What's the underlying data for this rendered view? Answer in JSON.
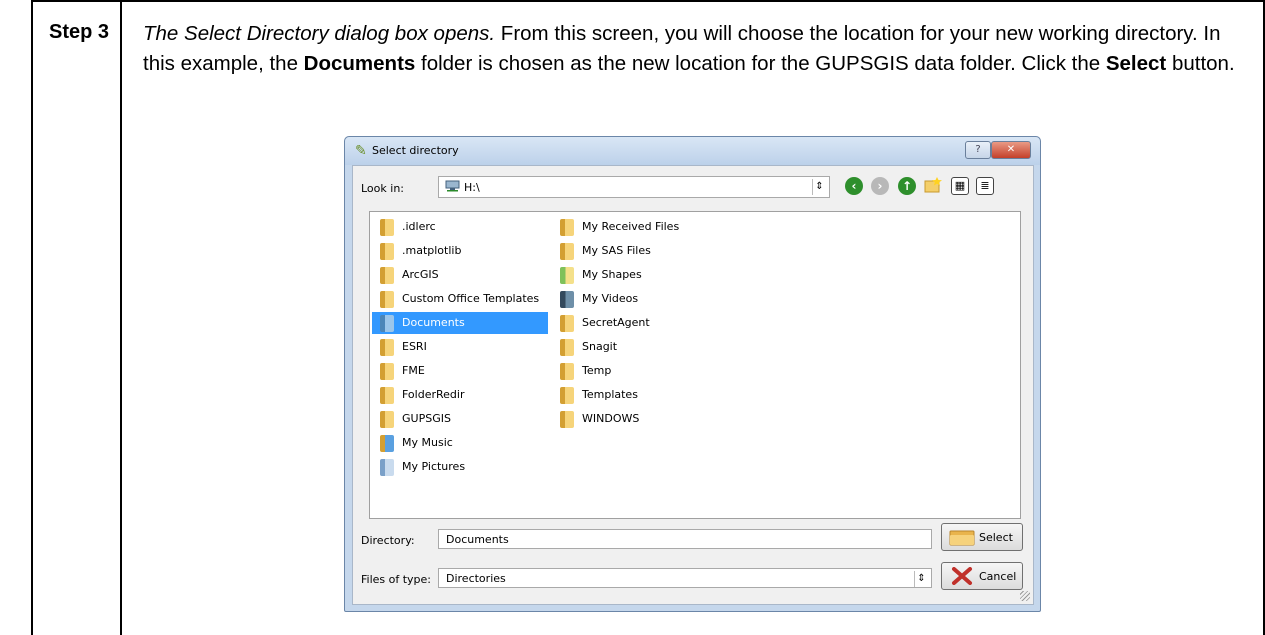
{
  "step": {
    "label": "Step 3",
    "text_italic": "The Select Directory dialog box opens.",
    "text_1": " From this screen, you will choose the location for your new working directory. In this example, the ",
    "bold_documents": "Documents",
    "text_2": " folder is chosen as the new location for the GUPSGIS data folder. Click the ",
    "bold_select": "Select",
    "text_3": " button."
  },
  "dialog": {
    "title": "Select directory",
    "help_label": "?",
    "close_label": "✕",
    "look_in_label": "Look in:",
    "look_in_value": "H:\\",
    "combo_arrow": "⇕",
    "icons": [
      "back-icon",
      "forward-icon",
      "up-icon",
      "new-folder-icon",
      "list-view-icon",
      "detail-view-icon"
    ],
    "files_col1": [
      ".idlerc",
      ".matplotlib",
      "ArcGIS",
      "Custom Office Templates",
      "Documents",
      "ESRI",
      "FME",
      "FolderRedir",
      "GUPSGIS",
      "My Music",
      "My Pictures"
    ],
    "files_col2": [
      "My Received Files",
      "My SAS Files",
      "My Shapes",
      "My Videos",
      "SecretAgent",
      "Snagit",
      "Temp",
      "Templates",
      "WINDOWS"
    ],
    "selected_item": "Documents",
    "directory_label": "Directory:",
    "directory_value": "Documents",
    "files_of_type_label": "Files of type:",
    "files_of_type_value": "Directories",
    "select_button": "Select",
    "cancel_button": "Cancel"
  }
}
